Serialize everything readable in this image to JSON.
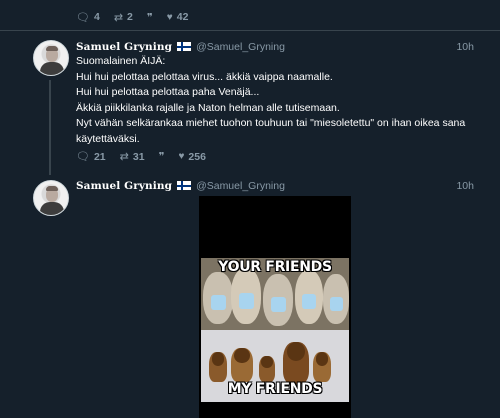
{
  "previous_tweet": {
    "actions": {
      "reply_count": "4",
      "retweet_count": "2",
      "like_count": "42"
    }
  },
  "tweet1": {
    "author_name": "Samuel Gryning",
    "handle": "@Samuel_Gryning",
    "time": "10h",
    "lines": [
      "Suomalainen ÄIJÄ:",
      "Hui hui pelottaa pelottaa virus... äkkiä vaippa naamalle.",
      "Hui hui pelottaa pelottaa paha Venäjä...",
      "Äkkiä piikkilanka rajalle ja Naton helman alle tutisemaan.",
      "Nyt vähän selkärankaa miehet tuohon touhuun tai \"miesoletettu\" on ihan oikea sana",
      "käytettäväksi."
    ],
    "actions": {
      "reply_count": "21",
      "retweet_count": "31",
      "like_count": "256"
    }
  },
  "tweet2": {
    "author_name": "Samuel Gryning",
    "handle": "@Samuel_Gryning",
    "time": "10h",
    "meme": {
      "top_caption": "YOUR FRIENDS",
      "bottom_caption": "MY FRIENDS"
    }
  },
  "icons": {
    "reply": "💬",
    "retweet": "⇄",
    "quote": "❞",
    "like": "♥"
  },
  "colors": {
    "background": "#15202b",
    "secondary_text": "#8899a6",
    "divider": "#38444d"
  }
}
